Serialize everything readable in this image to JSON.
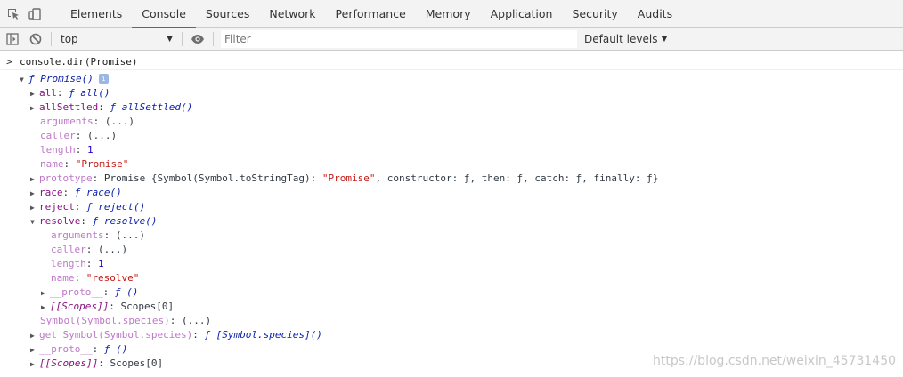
{
  "tabs": [
    {
      "label": "Elements"
    },
    {
      "label": "Console",
      "active": true
    },
    {
      "label": "Sources"
    },
    {
      "label": "Network"
    },
    {
      "label": "Performance"
    },
    {
      "label": "Memory"
    },
    {
      "label": "Application"
    },
    {
      "label": "Security"
    },
    {
      "label": "Audits"
    }
  ],
  "toolbar": {
    "context": "top",
    "filter_placeholder": "Filter",
    "filter_value": "",
    "levels_label": "Default levels"
  },
  "console": {
    "prompt": ">",
    "command": "console.dir(Promise)",
    "info_badge": "i",
    "lines": {
      "promise_fn": "ƒ Promise()",
      "all_key": "all",
      "all_val": "ƒ all()",
      "allSettled_key": "allSettled",
      "allSettled_val": "ƒ allSettled()",
      "arguments_key": "arguments",
      "arguments_val": "(...)",
      "caller_key": "caller",
      "caller_val": "(...)",
      "length_key": "length",
      "length_val": "1",
      "name_key": "name",
      "name_val": "\"Promise\"",
      "prototype_key": "prototype",
      "prototype_pre": "Promise {Symbol(Symbol.toStringTag): ",
      "prototype_str": "\"Promise\"",
      "prototype_post": ", constructor: ƒ, then: ƒ, catch: ƒ, finally: ƒ}",
      "race_key": "race",
      "race_val": "ƒ race()",
      "reject_key": "reject",
      "reject_val": "ƒ reject()",
      "resolve_key": "resolve",
      "resolve_val": "ƒ resolve()",
      "r_arguments_key": "arguments",
      "r_arguments_val": "(...)",
      "r_caller_key": "caller",
      "r_caller_val": "(...)",
      "r_length_key": "length",
      "r_length_val": "1",
      "r_name_key": "name",
      "r_name_val": "\"resolve\"",
      "r_proto_key": "__proto__",
      "r_proto_val": "ƒ ()",
      "r_scopes_key": "[[Scopes]]",
      "r_scopes_val": "Scopes[0]",
      "species_key": "Symbol(Symbol.species)",
      "species_val": "(...)",
      "get_species_key": "get Symbol(Symbol.species)",
      "get_species_val": "ƒ [Symbol.species]()",
      "proto_key": "__proto__",
      "proto_val": "ƒ ()",
      "scopes_key": "[[Scopes]]",
      "scopes_val": "Scopes[0]"
    }
  },
  "watermark": "https://blog.csdn.net/weixin_45731450"
}
